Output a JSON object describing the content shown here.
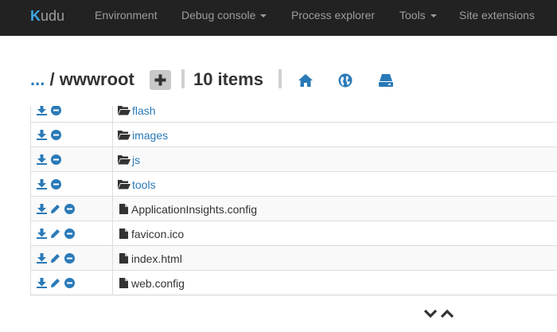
{
  "navbar": {
    "brand": {
      "first_letter": "K",
      "rest": "udu"
    },
    "items": [
      {
        "label": "Environment",
        "has_caret": false
      },
      {
        "label": "Debug console",
        "has_caret": true
      },
      {
        "label": "Process explorer",
        "has_caret": false
      },
      {
        "label": "Tools",
        "has_caret": true
      },
      {
        "label": "Site extensions",
        "has_caret": false
      }
    ]
  },
  "header": {
    "breadcrumb_root": "...",
    "breadcrumb_separator": "/",
    "current_folder": "wwwroot",
    "item_count": "10",
    "item_count_label": "items",
    "icons": [
      "home-icon",
      "globe-icon",
      "drive-icon"
    ]
  },
  "files": [
    {
      "name": "flash",
      "type": "folder",
      "actions": [
        "download-icon",
        "delete-icon"
      ]
    },
    {
      "name": "images",
      "type": "folder",
      "actions": [
        "download-icon",
        "delete-icon"
      ]
    },
    {
      "name": "js",
      "type": "folder",
      "actions": [
        "download-icon",
        "delete-icon"
      ]
    },
    {
      "name": "tools",
      "type": "folder",
      "actions": [
        "download-icon",
        "delete-icon"
      ]
    },
    {
      "name": "ApplicationInsights.config",
      "type": "file",
      "actions": [
        "download-icon",
        "edit-icon",
        "delete-icon"
      ]
    },
    {
      "name": "favicon.ico",
      "type": "file",
      "actions": [
        "download-icon",
        "edit-icon",
        "delete-icon"
      ]
    },
    {
      "name": "index.html",
      "type": "file",
      "actions": [
        "download-icon",
        "edit-icon",
        "delete-icon"
      ]
    },
    {
      "name": "web.config",
      "type": "file",
      "actions": [
        "download-icon",
        "edit-icon",
        "delete-icon"
      ]
    }
  ],
  "colors": {
    "navbar_bg": "#222222",
    "navbar_text": "#9d9d9d",
    "brand_accent": "#3ea8e5",
    "link": "#2a7ab8",
    "icon_blue": "#2a7ab8"
  }
}
